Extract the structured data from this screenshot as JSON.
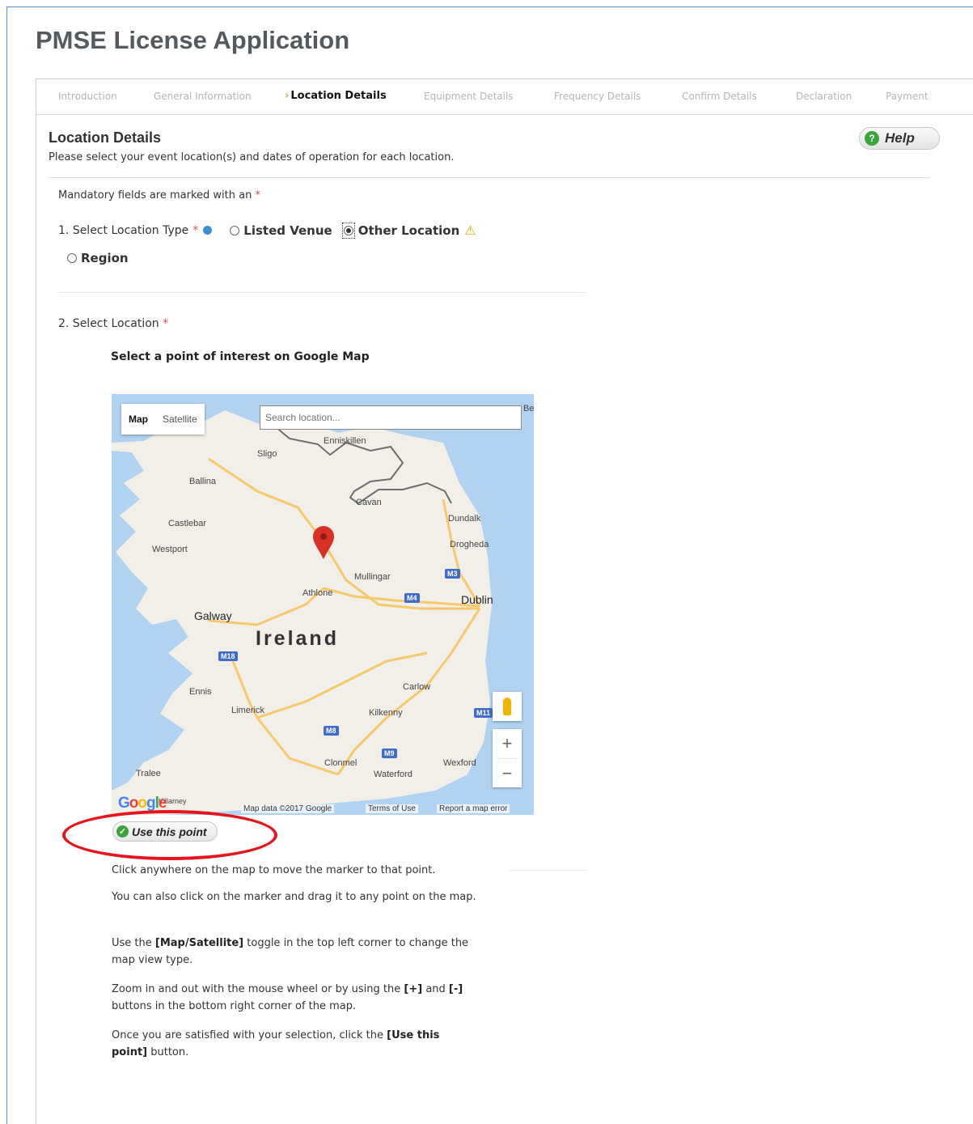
{
  "page": {
    "title": "PMSE License Application"
  },
  "steps": [
    {
      "label": "Introduction",
      "active": false
    },
    {
      "label": "General Information",
      "active": false
    },
    {
      "label": "Location Details",
      "active": true
    },
    {
      "label": "Equipment Details",
      "active": false
    },
    {
      "label": "Frequency Details",
      "active": false
    },
    {
      "label": "Confirm Details",
      "active": false
    },
    {
      "label": "Declaration",
      "active": false
    },
    {
      "label": "Payment",
      "active": false
    }
  ],
  "section": {
    "title": "Location Details",
    "subtitle": "Please select your event location(s) and dates of operation for each location.",
    "help_label": "Help"
  },
  "form": {
    "mandatory_note": "Mandatory fields are marked with an",
    "required_mark": "*",
    "location_type_label": "1. Select Location Type",
    "options": [
      {
        "label": "Listed Venue",
        "checked": false
      },
      {
        "label": "Other Location",
        "checked": true
      },
      {
        "label": "Region",
        "checked": false
      }
    ],
    "select_location_label": "2. Select Location"
  },
  "map": {
    "heading": "Select a point of interest on Google Map",
    "toggle": {
      "map": "Map",
      "satellite": "Satellite",
      "selected": "Map"
    },
    "search_placeholder": "Search location...",
    "country_label": "Ireland",
    "places": [
      "Sligo",
      "Enniskillen",
      "Ballina",
      "Cavan",
      "Dundalk",
      "Castlebar",
      "Westport",
      "Drogheda",
      "Mullingar",
      "Athlone",
      "Dublin",
      "Galway",
      "Ennis",
      "Limerick",
      "Carlow",
      "Kilkenny",
      "Clonmel",
      "Wexford",
      "Waterford",
      "Tralee",
      "Killarney",
      "Be"
    ],
    "road_shields": [
      "M3",
      "M4",
      "M18",
      "M11",
      "M8",
      "M9"
    ],
    "zoom_in": "+",
    "zoom_out": "−",
    "logo": "Google",
    "attribution": "Map data ©2017 Google",
    "terms": "Terms of Use",
    "report": "Report a map error",
    "marker": "Athlone"
  },
  "use_point_button": "Use this point",
  "instructions": {
    "p1": "Click anywhere on the map to move the marker to that point.",
    "p2": "You can also click on the marker and drag it to any point on the map.",
    "p3_pre": "Use the",
    "p3_bold": "[Map/Satellite]",
    "p3_post": "toggle in the top left corner to change the map view type.",
    "p4_pre": "Zoom in and out with the mouse wheel or by using the",
    "p4_plus": "[+]",
    "p4_and": "and",
    "p4_minus": "[-]",
    "p4_post": "buttons in the bottom right corner of the map.",
    "p5_pre": "Once you are satisfied with your selection, click the",
    "p5_bold": "[Use this point]",
    "p5_post": "button."
  },
  "colors": {
    "required": "#d9534f",
    "annotation_ellipse": "#e8141b",
    "help_icon": "#3aa53a",
    "step_arrow": "#e6a23c",
    "marker": "#d93025"
  },
  "icons": [
    "help-icon",
    "info-icon",
    "warning-icon",
    "check-icon",
    "map-marker-icon",
    "pegman-icon"
  ]
}
